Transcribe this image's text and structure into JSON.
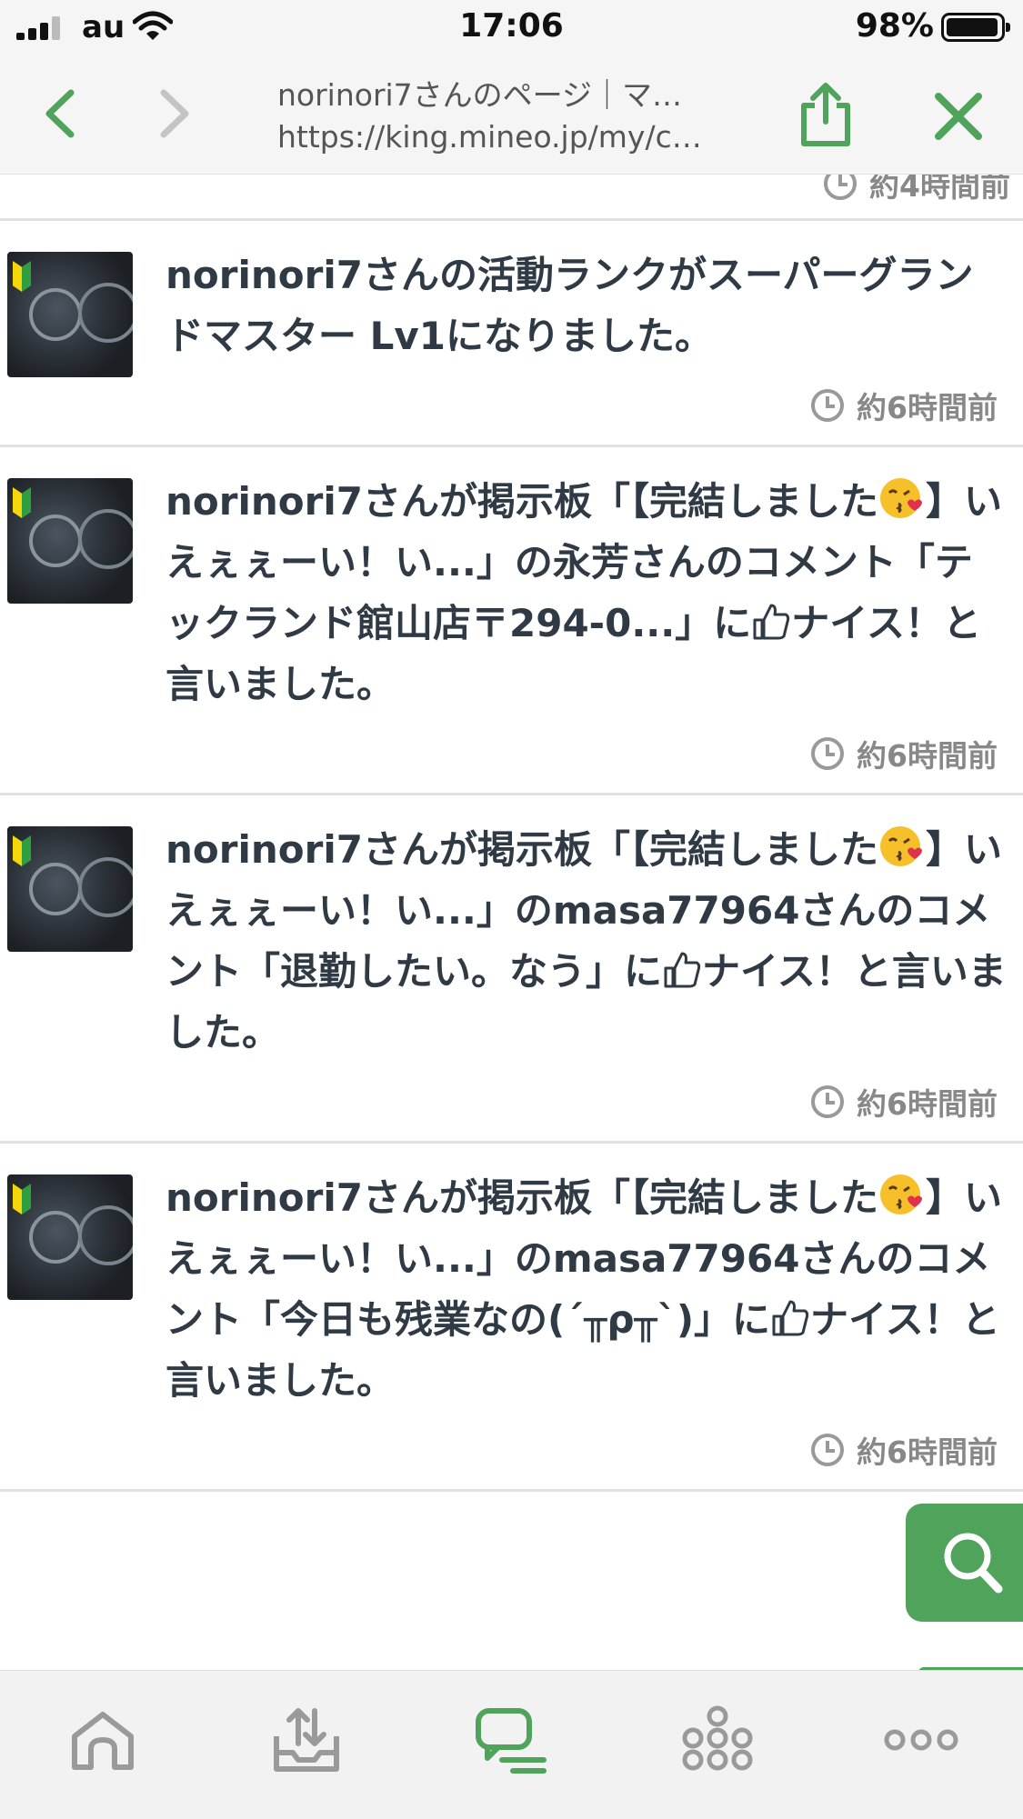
{
  "status_bar": {
    "carrier": "au",
    "time": "17:06",
    "battery_percent": "98%",
    "battery_level": 0.98
  },
  "browser": {
    "page_title": "norinori7さんのページ｜マ…",
    "url": "https://king.mineo.jp/my/c…"
  },
  "feed": {
    "first_time": "約4時間前",
    "entries": [
      {
        "text": "norinori7さんの活動ランクがスーパーグランドマスター Lv1になりました。",
        "time": "約6時間前"
      },
      {
        "text_a": "norinori7さんが掲示板「【完結しました",
        "text_b": "】いえぇぇーい！い...」の永芳さんのコメント「テックランド館山店〒294-0...」に",
        "text_c": "ナイス！と言いました。",
        "time": "約6時間前"
      },
      {
        "text_a": "norinori7さんが掲示板「【完結しました",
        "text_b": "】いえぇぇーい！い...」のmasa77964さんのコメント「退勤したい。なう」に",
        "text_c": "ナイス！と言いました。",
        "time": "約6時間前"
      },
      {
        "text_a": "norinori7さんが掲示板「【完結しました",
        "text_b": "】いえぇぇーい！い...」のmasa77964さんのコメント「今日も残業なの(´╥ρ╥`)」に",
        "text_c": "ナイス！と言いました。",
        "time": "約6時間前"
      }
    ]
  },
  "colors": {
    "accent_green": "#4fa35a",
    "text_dark": "#2f3a45",
    "text_gray": "#888888"
  },
  "tab_bar": {
    "icons": [
      "home-icon",
      "inbox-icon",
      "chat-icon",
      "community-icon",
      "more-icon"
    ],
    "active": "chat-icon"
  }
}
